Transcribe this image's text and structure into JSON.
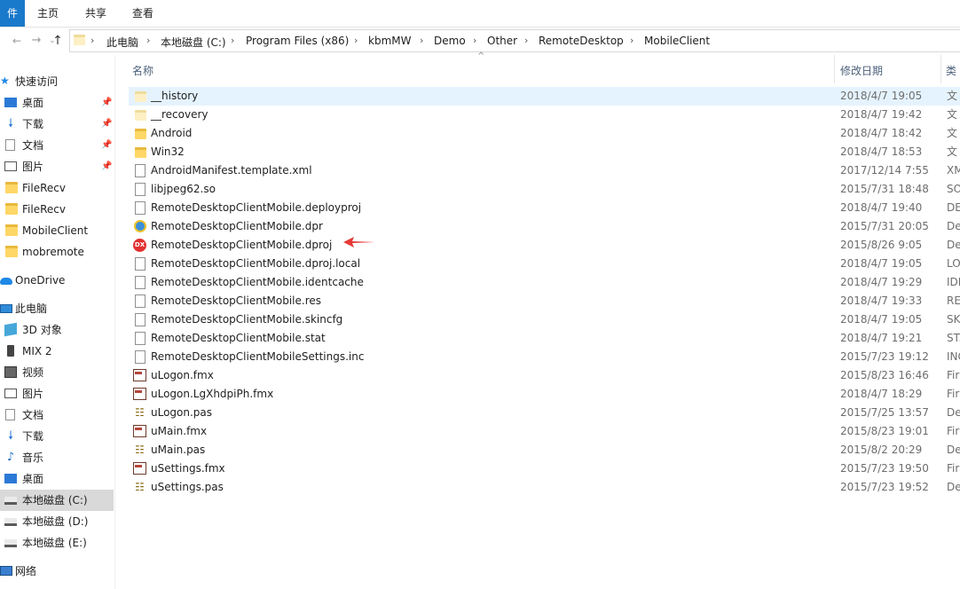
{
  "ribbon": {
    "tabs": [
      "件",
      "主页",
      "共享",
      "查看"
    ]
  },
  "address_bar": {
    "back_icon": "back-arrow-icon",
    "forward_icon": "forward-arrow-icon",
    "dropdown_icon": "chevron-down-icon",
    "up_icon": "up-arrow-icon",
    "crumbs": [
      "此电脑",
      "本地磁盘 (C:)",
      "Program Files (x86)",
      "kbmMW",
      "Demo",
      "Other",
      "RemoteDesktop",
      "MobileClient"
    ]
  },
  "sidebar": {
    "items": [
      {
        "label": "快速访问",
        "icon": "star-icon",
        "group": true
      },
      {
        "label": "桌面",
        "icon": "desktop-icon",
        "pinned": true
      },
      {
        "label": "下载",
        "icon": "download-icon",
        "pinned": true
      },
      {
        "label": "文档",
        "icon": "document-icon",
        "pinned": true
      },
      {
        "label": "图片",
        "icon": "pictures-icon",
        "pinned": true
      },
      {
        "label": "FileRecv",
        "icon": "folder-icon"
      },
      {
        "label": "FileRecv",
        "icon": "folder-icon"
      },
      {
        "label": "MobileClient",
        "icon": "folder-icon"
      },
      {
        "label": "mobremote",
        "icon": "folder-icon"
      },
      {
        "label": "OneDrive",
        "icon": "cloud-icon",
        "group": true
      },
      {
        "label": "此电脑",
        "icon": "pc-icon",
        "group": true
      },
      {
        "label": "3D 对象",
        "icon": "cube-icon"
      },
      {
        "label": "MIX 2",
        "icon": "phone-icon"
      },
      {
        "label": "视频",
        "icon": "video-icon"
      },
      {
        "label": "图片",
        "icon": "pictures-icon"
      },
      {
        "label": "文档",
        "icon": "document-icon"
      },
      {
        "label": "下载",
        "icon": "download-icon"
      },
      {
        "label": "音乐",
        "icon": "music-icon"
      },
      {
        "label": "桌面",
        "icon": "desktop-icon"
      },
      {
        "label": "本地磁盘 (C:)",
        "icon": "drive-icon",
        "selected": true
      },
      {
        "label": "本地磁盘 (D:)",
        "icon": "drive-icon"
      },
      {
        "label": "本地磁盘 (E:)",
        "icon": "drive-icon"
      },
      {
        "label": "网络",
        "icon": "network-icon",
        "group": true
      }
    ]
  },
  "list": {
    "columns": {
      "name": "名称",
      "date": "修改日期",
      "type": "类"
    },
    "sort_indicator": "^",
    "files": [
      {
        "name": "__history",
        "date": "2018/4/7 19:05",
        "type": "文",
        "icon": "folder-icon",
        "selected": true
      },
      {
        "name": "__recovery",
        "date": "2018/4/7 19:42",
        "type": "文",
        "icon": "folder-pale-icon"
      },
      {
        "name": "Android",
        "date": "2018/4/7 18:42",
        "type": "文",
        "icon": "folder-icon"
      },
      {
        "name": "Win32",
        "date": "2018/4/7 18:53",
        "type": "文",
        "icon": "folder-icon"
      },
      {
        "name": "AndroidManifest.template.xml",
        "date": "2017/12/14 7:55",
        "type": "XM",
        "icon": "file-icon"
      },
      {
        "name": "libjpeg62.so",
        "date": "2015/7/31 18:48",
        "type": "SO",
        "icon": "file-icon"
      },
      {
        "name": "RemoteDesktopClientMobile.deployproj",
        "date": "2018/4/7 19:40",
        "type": "DE",
        "icon": "file-icon"
      },
      {
        "name": "RemoteDesktopClientMobile.dpr",
        "date": "2015/7/31 20:05",
        "type": "De",
        "icon": "dpr-icon"
      },
      {
        "name": "RemoteDesktopClientMobile.dproj",
        "date": "2015/8/26 9:05",
        "type": "De",
        "icon": "dx-icon"
      },
      {
        "name": "RemoteDesktopClientMobile.dproj.local",
        "date": "2018/4/7 19:05",
        "type": "LO",
        "icon": "file-icon"
      },
      {
        "name": "RemoteDesktopClientMobile.identcache",
        "date": "2018/4/7 19:29",
        "type": "IDI",
        "icon": "file-icon"
      },
      {
        "name": "RemoteDesktopClientMobile.res",
        "date": "2018/4/7 19:33",
        "type": "RE",
        "icon": "file-icon"
      },
      {
        "name": "RemoteDesktopClientMobile.skincfg",
        "date": "2018/4/7 19:05",
        "type": "SK",
        "icon": "file-icon"
      },
      {
        "name": "RemoteDesktopClientMobile.stat",
        "date": "2018/4/7 19:21",
        "type": "ST.",
        "icon": "file-icon"
      },
      {
        "name": "RemoteDesktopClientMobileSettings.inc",
        "date": "2015/7/23 19:12",
        "type": "INC",
        "icon": "file-icon"
      },
      {
        "name": "uLogon.fmx",
        "date": "2015/8/23 16:46",
        "type": "Fir",
        "icon": "fmx-icon"
      },
      {
        "name": "uLogon.LgXhdpiPh.fmx",
        "date": "2018/4/7 18:29",
        "type": "Fir",
        "icon": "fmx-icon"
      },
      {
        "name": "uLogon.pas",
        "date": "2015/7/25 13:57",
        "type": "De",
        "icon": "pas-icon"
      },
      {
        "name": "uMain.fmx",
        "date": "2015/8/23 19:01",
        "type": "Fir",
        "icon": "fmx-icon"
      },
      {
        "name": "uMain.pas",
        "date": "2015/8/2 20:29",
        "type": "De",
        "icon": "pas-icon"
      },
      {
        "name": "uSettings.fmx",
        "date": "2015/7/23 19:50",
        "type": "Fir",
        "icon": "fmx-icon"
      },
      {
        "name": "uSettings.pas",
        "date": "2015/7/23 19:52",
        "type": "De",
        "icon": "pas-icon"
      }
    ]
  },
  "annotation": {
    "icon": "red-arrow-icon",
    "color": "#e53935"
  },
  "colors": {
    "accent": "#1979ca",
    "selection": "#e5f3ff",
    "sidebar_selected": "#d9d9d9"
  }
}
